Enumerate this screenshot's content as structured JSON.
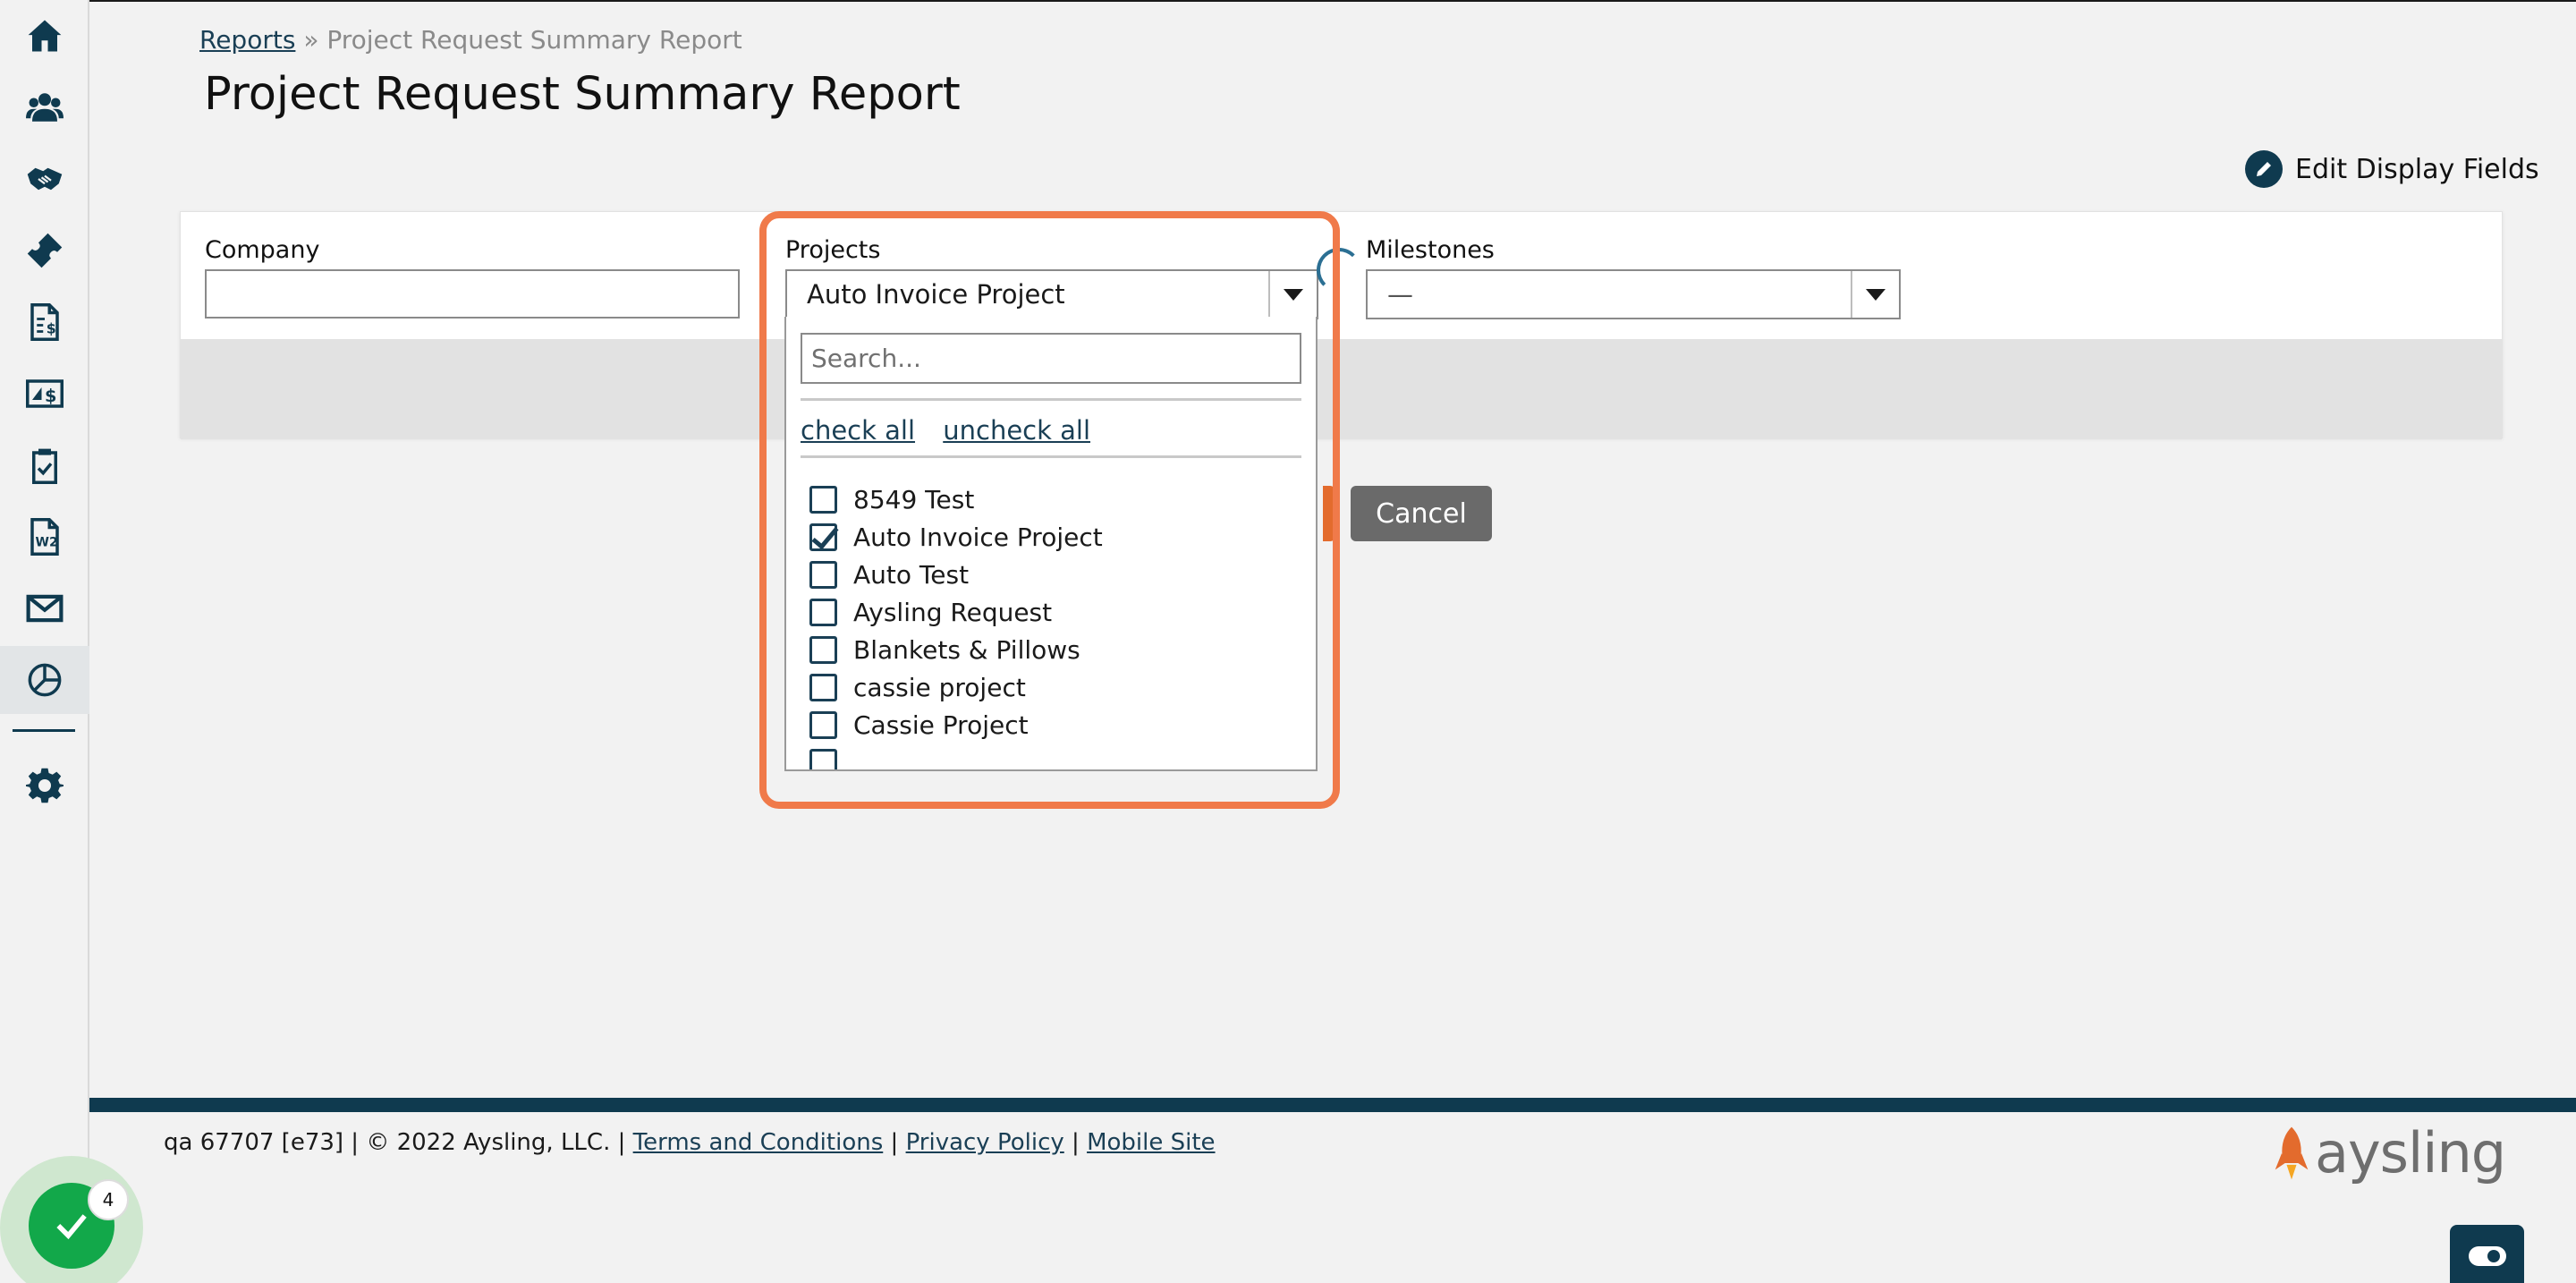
{
  "breadcrumb": {
    "root": "Reports",
    "separator": "»",
    "current": "Project Request Summary Report"
  },
  "page_title": "Project Request Summary Report",
  "edit_fields_label": "Edit Display Fields",
  "filters": {
    "company_label": "Company",
    "company_value": "",
    "projects_label": "Projects",
    "projects_selected": "Auto Invoice Project",
    "milestones_label": "Milestones",
    "milestones_selected": "—"
  },
  "buttons": {
    "cancel": "Cancel"
  },
  "dropdown": {
    "search_placeholder": "Search...",
    "check_all": "check all",
    "uncheck_all": "uncheck all",
    "options": [
      {
        "label": "8549 Test",
        "checked": false
      },
      {
        "label": "Auto Invoice Project",
        "checked": true
      },
      {
        "label": "Auto Test",
        "checked": false
      },
      {
        "label": "Aysling Request",
        "checked": false
      },
      {
        "label": "Blankets & Pillows",
        "checked": false
      },
      {
        "label": "cassie project",
        "checked": false
      },
      {
        "label": "Cassie Project",
        "checked": false
      }
    ]
  },
  "footer": {
    "version": "qa 67707 [e73] | © 2022 Aysling, LLC. |",
    "terms": "Terms and Conditions",
    "divider": "|",
    "privacy": "Privacy Policy",
    "mobile": "Mobile Site",
    "logo_text": "aysling"
  },
  "task_widget": {
    "count": "4"
  },
  "colors": {
    "navy": "#0f3a4f",
    "accent_orange": "#f07a4a",
    "success_green": "#12a84a"
  },
  "sidebar_icons": [
    "home-icon",
    "people-icon",
    "handshake-icon",
    "ticket-icon",
    "invoice-icon",
    "money-exchange-icon",
    "clipboard-check-icon",
    "w2-form-icon",
    "mail-icon",
    "reports-chart-icon",
    "settings-gear-icon"
  ]
}
